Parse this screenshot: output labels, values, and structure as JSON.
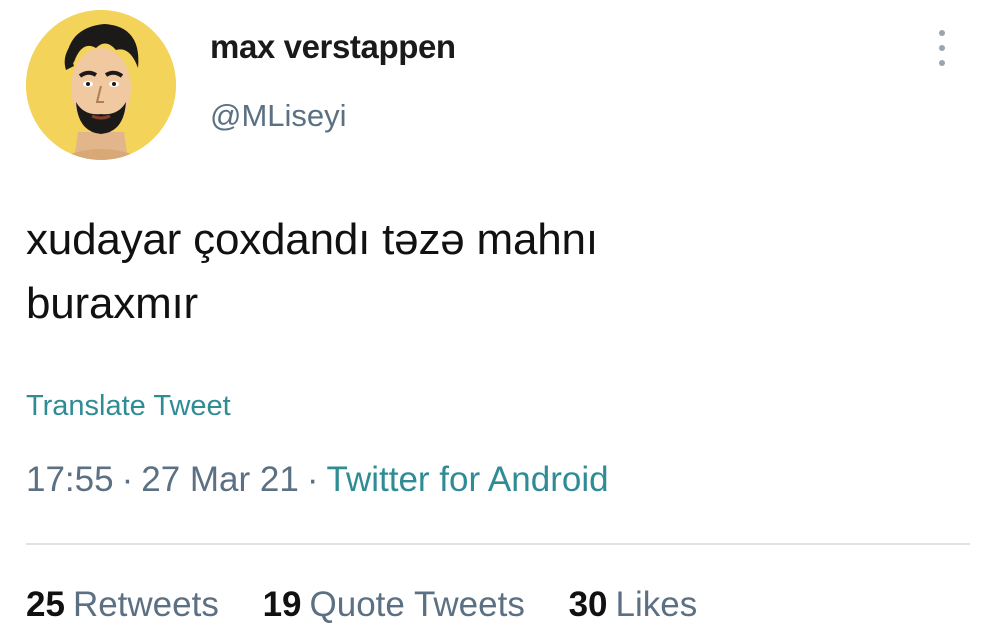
{
  "tweet": {
    "author": {
      "display_name": "max verstappen",
      "handle": "@MLiseyi",
      "avatar_icon": "cartoon-man-avatar"
    },
    "more_icon": "vertical-ellipsis-icon",
    "text_line1": "xudayar çoxdandı təzə mahnı",
    "text_line2": "buraxmır",
    "translate_label": "Translate Tweet",
    "time": "17:55",
    "date": "27 Mar 21",
    "separator": "·",
    "source": "Twitter for Android",
    "stats": {
      "retweets_count": "25",
      "retweets_label": "Retweets",
      "quotes_count": "19",
      "quotes_label": "Quote Tweets",
      "likes_count": "30",
      "likes_label": "Likes"
    },
    "colors": {
      "link": "#2f8c95",
      "muted": "#5b7083",
      "avatar_bg": "#f4d35a"
    }
  }
}
